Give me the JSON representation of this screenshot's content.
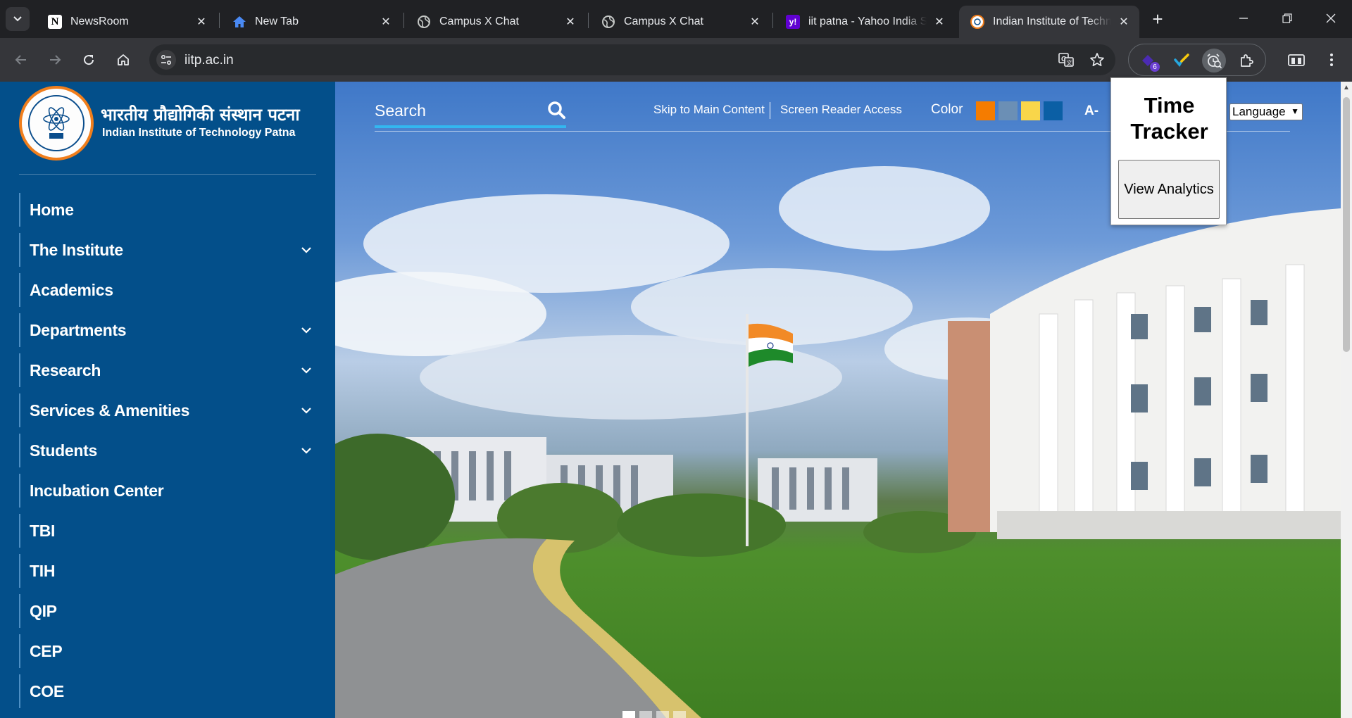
{
  "browser": {
    "tabs": [
      {
        "title": "NewsRoom",
        "favicon": "notion-icon"
      },
      {
        "title": "New Tab",
        "favicon": "home-icon"
      },
      {
        "title": "Campus X Chat",
        "favicon": "globe-icon"
      },
      {
        "title": "Campus X Chat",
        "favicon": "globe-icon"
      },
      {
        "title": "iit patna - Yahoo India Se",
        "favicon": "yahoo-icon"
      },
      {
        "title": "Indian Institute of Techno",
        "favicon": "iitp-seal-icon",
        "active": true
      }
    ],
    "address_bar": {
      "url": "iitp.ac.in"
    },
    "extension_badge": "6",
    "colors": {
      "tabstrip": "#202124",
      "toolbar": "#35363a",
      "omnibox": "#282a2d"
    }
  },
  "page": {
    "logo": {
      "hindi": "भारतीय प्रौद्योगिकी संस्थान पटना",
      "english": "Indian Institute of Technology Patna"
    },
    "nav": [
      {
        "label": "Home",
        "has_submenu": false
      },
      {
        "label": "The Institute",
        "has_submenu": true
      },
      {
        "label": "Academics",
        "has_submenu": false
      },
      {
        "label": "Departments",
        "has_submenu": true
      },
      {
        "label": "Research",
        "has_submenu": true
      },
      {
        "label": "Services & Amenities",
        "has_submenu": true
      },
      {
        "label": "Students",
        "has_submenu": true
      },
      {
        "label": "Incubation Center",
        "has_submenu": false
      },
      {
        "label": "TBI",
        "has_submenu": false
      },
      {
        "label": "TIH",
        "has_submenu": false
      },
      {
        "label": "QIP",
        "has_submenu": false
      },
      {
        "label": "CEP",
        "has_submenu": false
      },
      {
        "label": "COE",
        "has_submenu": false
      }
    ],
    "topbar": {
      "search_label": "Search",
      "skip_link": "Skip to Main Content",
      "screen_reader": "Screen Reader Access",
      "color_label": "Color",
      "color_swatches": [
        "#f57c00",
        "#6b8fb5",
        "#f9d64a",
        "#0b5fa5"
      ],
      "font_decrease": "A-",
      "language_select": "Language"
    },
    "colors": {
      "sidebar": "#034f8a",
      "accent_search_underline": "#33b7f0"
    }
  },
  "popup": {
    "title": "Time Tracker",
    "button": "View Analytics"
  }
}
